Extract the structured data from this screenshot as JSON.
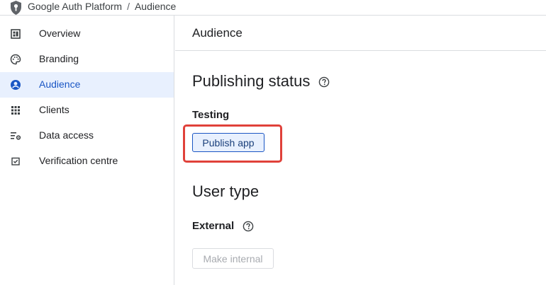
{
  "breadcrumb": {
    "root": "Google Auth Platform",
    "separator": "/",
    "current": "Audience"
  },
  "sidebar": {
    "items": [
      {
        "label": "Overview",
        "icon": "dashboard-icon",
        "active": false
      },
      {
        "label": "Branding",
        "icon": "palette-icon",
        "active": false
      },
      {
        "label": "Audience",
        "icon": "account-circle-icon",
        "active": true
      },
      {
        "label": "Clients",
        "icon": "apps-grid-icon",
        "active": false
      },
      {
        "label": "Data access",
        "icon": "data-access-icon",
        "active": false
      },
      {
        "label": "Verification centre",
        "icon": "verification-icon",
        "active": false
      }
    ]
  },
  "main": {
    "title": "Audience",
    "publishing": {
      "heading": "Publishing status",
      "status": "Testing",
      "button_label": "Publish app"
    },
    "user_type": {
      "heading": "User type",
      "value": "External",
      "button_label": "Make internal"
    }
  },
  "colors": {
    "accent": "#1a56c4",
    "active_bg": "#e8f0fe",
    "highlight": "#e0413a",
    "divider": "#dadce0"
  }
}
